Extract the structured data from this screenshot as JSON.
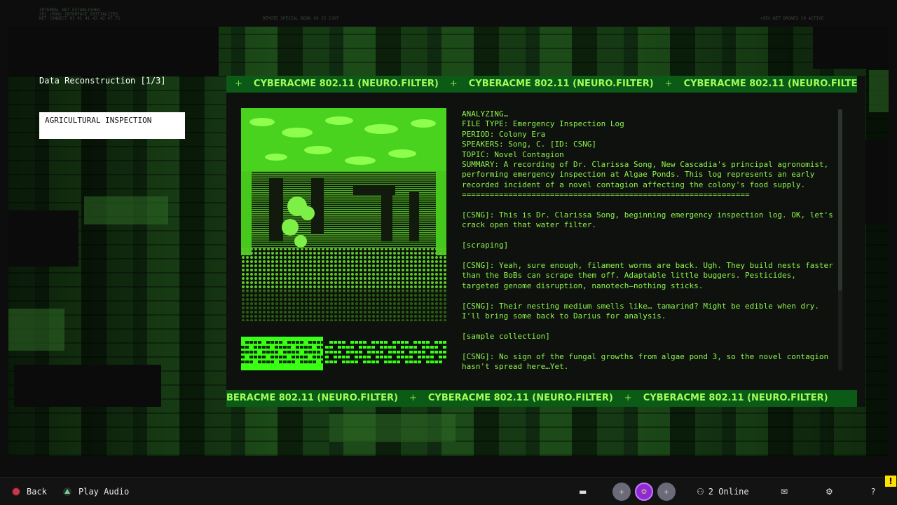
{
  "hud": {
    "top_left": "INTERNAL NET ESTABLISHED\nSEC (MON) INTERFACE INITIALIZED\nNET CONNECT 01 01 41 43 42 47 71",
    "top_center": "REMOTE SPECIAL BOOK 09 25 1307",
    "top_right": "<SEC-NET DRONES 10 ACTIVE"
  },
  "reconstruction": {
    "title": "Data Reconstruction [1/3]",
    "entry_label": "AGRICULTURAL INSPECTION"
  },
  "banner": {
    "text": "CYBERACME 802.11 (NEURO.FILTER)",
    "separator": "+"
  },
  "log": {
    "lines": [
      "ANALYZING…",
      "FILE TYPE: Emergency Inspection Log",
      "PERIOD: Colony Era",
      "SPEAKERS: Song, C. [ID: CSNG]",
      "TOPIC: Novel Contagion",
      "SUMMARY: A recording of Dr. Clarissa Song, New Cascadia's principal agronomist, performing emergency inspection at Algae Ponds. This log represents an early recorded incident of a novel contagion affecting the colony's food supply.",
      "==============================================================",
      "",
      "[CSNG]: This is Dr. Clarissa Song, beginning emergency inspection log. OK, let's crack open that water filter.",
      "",
      "[scraping]",
      "",
      "[CSNG]: Yeah, sure enough, filament worms are back. Ugh. They build nests faster than the BoBs can scrape them off. Adaptable little buggers. Pesticides, targeted genome disruption, nanotech—nothing sticks.",
      "",
      "[CSNG]: Their nesting medium smells like… tamarind? Might be edible when dry. I'll bring some back to Darius for analysis.",
      "",
      "[sample collection]",
      "",
      "[CSNG]: No sign of the fungal growths from algae pond 3, so the novel contagion hasn't spread here…Yet."
    ]
  },
  "audio": {
    "progress": 0.4
  },
  "bottombar": {
    "back_label": "Back",
    "play_audio_label": "Play Audio",
    "online_label": "2 Online",
    "avatar_plus": "+",
    "warning": "!"
  },
  "colors": {
    "accent": "#8cf54c",
    "banner_bg": "#0b5a16",
    "warning": "#ffe100",
    "user_avatar": "#8c2ad8"
  }
}
